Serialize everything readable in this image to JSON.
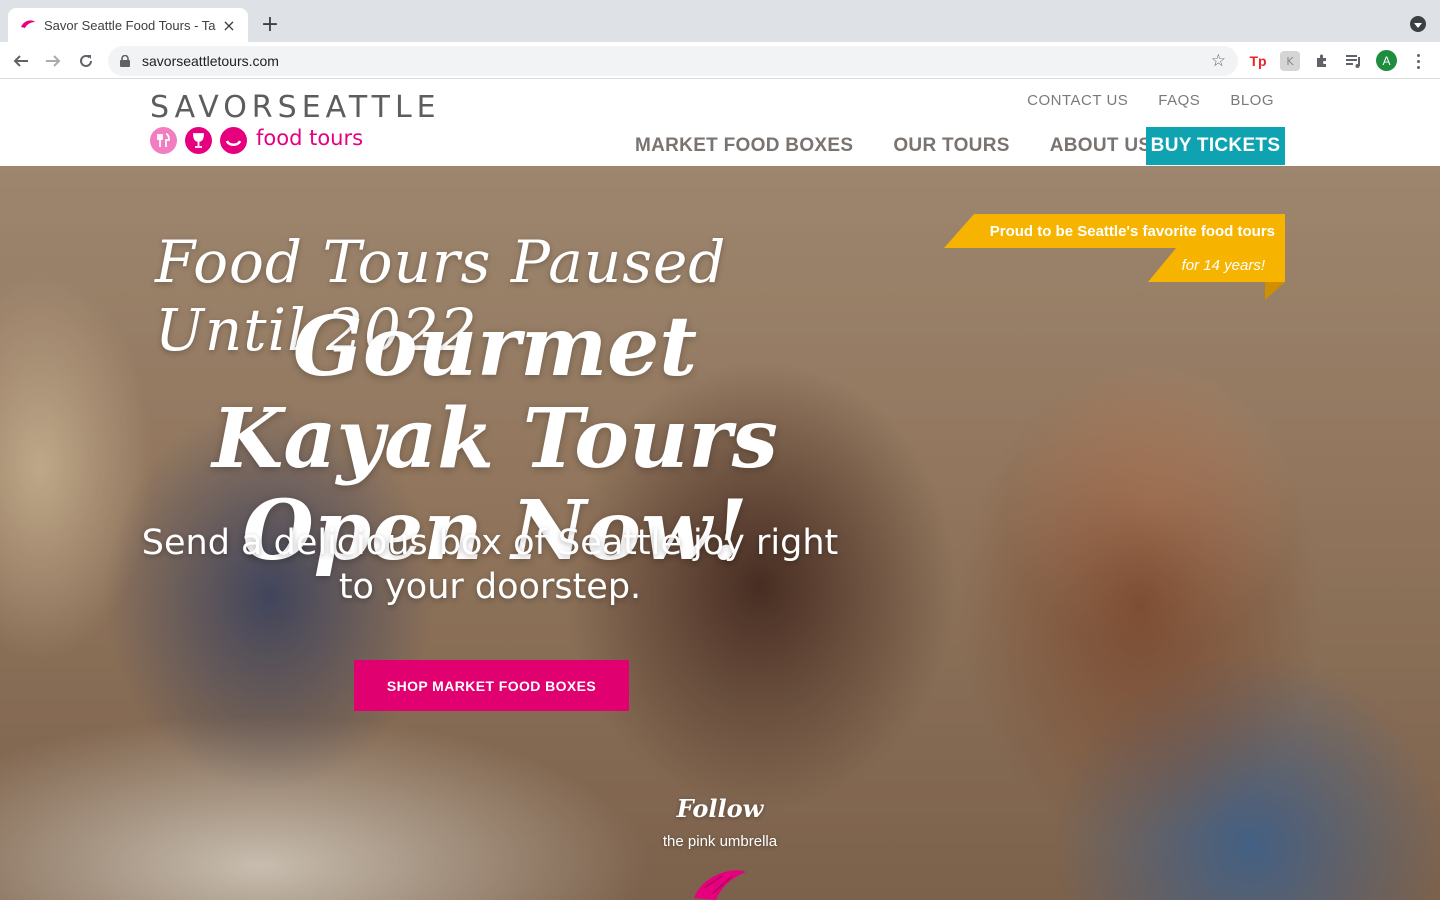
{
  "browser": {
    "tab_title": "Savor Seattle Food Tours - Tas",
    "url": "savorseattletours.com",
    "profile_initial": "A",
    "ext_tp_label": "Tp",
    "ext_k_label": "K"
  },
  "header": {
    "logo_word": "SAVORSEATTLE",
    "logo_sub": "food tours",
    "util_nav": [
      "CONTACT US",
      "FAQS",
      "BLOG"
    ],
    "main_nav": [
      "MARKET FOOD BOXES",
      "OUR TOURS",
      "ABOUT US"
    ],
    "buy_tickets": "BUY TICKETS"
  },
  "hero": {
    "line1": "Food Tours Paused Until 2022",
    "line2": "Gourmet Kayak Tours Open Now!",
    "subtitle": "Send a delicious box of Seattle joy right to your doorstep.",
    "cta": "SHOP MARKET FOOD BOXES",
    "ribbon_line1": "Proud to be Seattle's favorite food tours",
    "ribbon_line2": "for 14 years!",
    "follow_title": "Follow",
    "follow_sub": "the pink umbrella"
  },
  "colors": {
    "brand_pink": "#e6007e",
    "cta_pink": "#e0006f",
    "teal": "#0fa3b1",
    "ribbon_yellow": "#f6b400",
    "nav_gray": "#7a7471"
  }
}
